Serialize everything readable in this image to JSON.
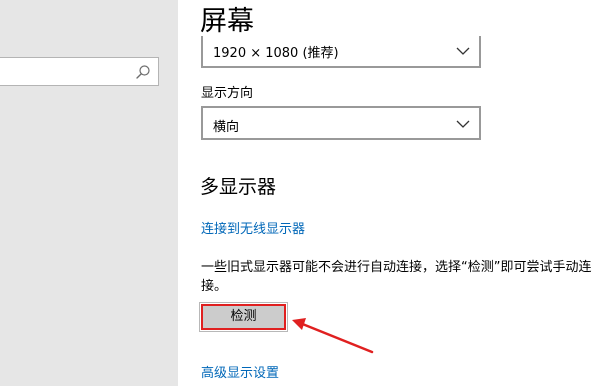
{
  "sidebar": {
    "search": {
      "placeholder": "",
      "icon": "search-icon"
    }
  },
  "main": {
    "title": "屏幕",
    "resolution": {
      "value": "1920 × 1080 (推荐)",
      "icon": "chevron-down-icon"
    },
    "orientation": {
      "label": "显示方向",
      "value": "横向",
      "icon": "chevron-down-icon"
    },
    "multi_display": {
      "heading": "多显示器",
      "wireless_link": "连接到无线显示器",
      "description": "一些旧式显示器可能不会进行自动连接，选择“检测”即可尝试手动连接。",
      "detect_button": "检测"
    },
    "advanced_link": "高级显示设置"
  },
  "annotation": {
    "highlight_color": "#e02020",
    "arrow_icon": "red-arrow-pointer"
  }
}
